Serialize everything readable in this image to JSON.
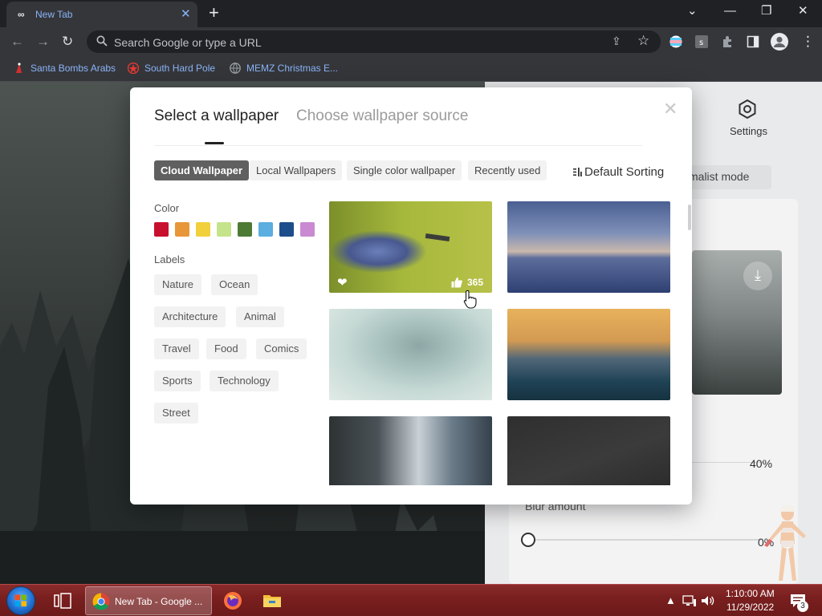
{
  "browser": {
    "tab": {
      "title": "New Tab",
      "favicon": "infinity-icon",
      "close": "✕"
    },
    "new_tab": "+",
    "window_controls": {
      "tab_search": "⌄",
      "minimize": "—",
      "restore": "❐",
      "close": "✕"
    },
    "nav": {
      "back": "←",
      "forward": "→",
      "reload": "↻"
    },
    "omnibox": {
      "placeholder": "Search Google or type a URL"
    },
    "bookmarks": [
      {
        "label": "Santa Bombs Arabs",
        "icon": "santa-icon"
      },
      {
        "label": "South Hard Pole",
        "icon": "red-star-icon"
      },
      {
        "label": "MEMZ Christmas E...",
        "icon": "globe-icon"
      }
    ]
  },
  "background_page": {
    "settings_label": "Settings",
    "minimalist_mode_label": "malist mode",
    "opacity_percent": "40%",
    "blur_label": "Blur amount",
    "blur_percent": "0%"
  },
  "modal": {
    "tabs": {
      "active": "Select a wallpaper",
      "other": "Choose wallpaper source"
    },
    "close": "✕",
    "filters": [
      {
        "label": "Cloud Wallpaper",
        "active": true
      },
      {
        "label": "Local Wallpapers",
        "active": false
      },
      {
        "label": "Single color wallpaper",
        "active": false
      },
      {
        "label": "Recently used",
        "active": false
      }
    ],
    "sort_label": "Default Sorting",
    "color_heading": "Color",
    "colors": [
      "#c8102e",
      "#e8963a",
      "#f2d03b",
      "#c5e38b",
      "#4d7a35",
      "#5aaee0",
      "#1e4d8c",
      "#c98ad1"
    ],
    "labels_heading": "Labels",
    "labels": [
      "Nature",
      "Ocean",
      "Architecture",
      "Animal",
      "Travel",
      "Food",
      "Comics",
      "Sports",
      "Technology",
      "Street"
    ],
    "wallpapers": [
      {
        "subject": "nuthatch bird",
        "likes": "365"
      },
      {
        "subject": "lake at dusk"
      },
      {
        "subject": "smoke cloud"
      },
      {
        "subject": "ocean wave and coast"
      },
      {
        "subject": "city buildings"
      },
      {
        "subject": "dark stone steps"
      }
    ]
  },
  "taskbar": {
    "chrome_task_label": "New Tab - Google ...",
    "time": "1:10:00 AM",
    "date": "11/29/2022",
    "notification_count": "3"
  }
}
